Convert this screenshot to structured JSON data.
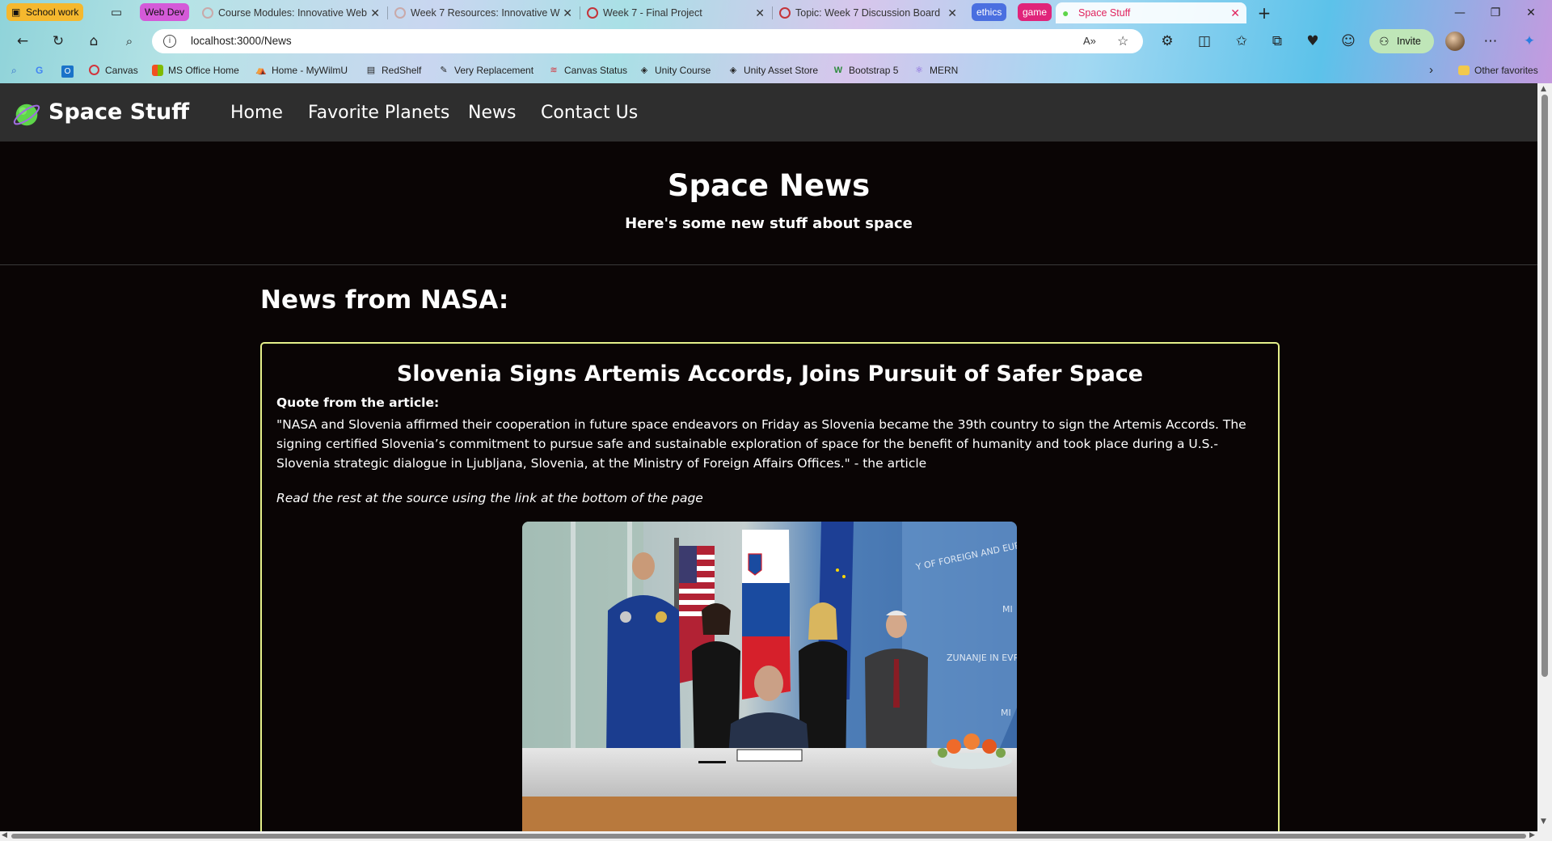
{
  "browser": {
    "tab_groups": [
      {
        "label": "School work",
        "color": "#f5b82e"
      },
      {
        "label": "Web Dev",
        "color": "#d45ad8"
      },
      {
        "label": "ethics",
        "color": "#4a6fe0"
      },
      {
        "label": "game",
        "color": "#e0247a"
      }
    ],
    "tabs": [
      {
        "title": "Course Modules: Innovative Web",
        "favicon": "canvas-icon"
      },
      {
        "title": "Week 7 Resources: Innovative W",
        "favicon": "canvas-icon"
      },
      {
        "title": "Week 7 - Final Project",
        "favicon": "canvas-icon"
      },
      {
        "title": "Topic: Week 7 Discussion Board",
        "favicon": "canvas-icon"
      },
      {
        "title": "Space Stuff",
        "favicon": "planet-icon",
        "active": true
      }
    ],
    "address_bar": {
      "url": "localhost:3000/News"
    },
    "invite_label": "Invite",
    "bookmarks": [
      {
        "label": "Canvas",
        "icon": "canvas-icon"
      },
      {
        "label": "MS Office Home",
        "icon": "office-icon"
      },
      {
        "label": "Home - MyWilmU",
        "icon": "wilmu-icon"
      },
      {
        "label": "RedShelf",
        "icon": "book-icon"
      },
      {
        "label": "Very Replacement",
        "icon": "pen-icon"
      },
      {
        "label": "Canvas Status",
        "icon": "status-icon"
      },
      {
        "label": "Unity Course",
        "icon": "unity-icon"
      },
      {
        "label": "Unity Asset Store",
        "icon": "unity-icon"
      },
      {
        "label": "Bootstrap 5",
        "icon": "bootstrap-icon"
      },
      {
        "label": "MERN",
        "icon": "react-icon"
      }
    ],
    "other_favorites_label": "Other favorites"
  },
  "site": {
    "brand": "Space Stuff",
    "nav": [
      {
        "label": "Home"
      },
      {
        "label": "Favorite Planets"
      },
      {
        "label": "News"
      },
      {
        "label": "Contact Us"
      }
    ],
    "hero": {
      "title": "Space News",
      "subtitle": "Here's some new stuff about space"
    },
    "section_heading": "News from NASA:",
    "article": {
      "title": "Slovenia Signs Artemis Accords, Joins Pursuit of Safer Space",
      "quote_label": "Quote from the article:",
      "quote": "\"NASA and Slovenia affirmed their cooperation in future space endeavors on Friday as Slovenia became the 39th country to sign the Artemis Accords. The signing certified Slovenia’s commitment to pursue safe and sustainable exploration of space for the benefit of humanity and took place during a U.S.-Slovenia strategic dialogue in Ljubljana, Slovenia, at the Ministry of Foreign Affairs Offices.\" - the article",
      "read_more": "Read the rest at the source using the link at the bottom of the page",
      "photo_wall_text": [
        "Y OF FOREIGN AND EURO",
        "MI",
        "ZUNANJE IN EVRO",
        "MI"
      ]
    },
    "colors": {
      "navbar_bg": "#2e2e2e",
      "page_bg": "#0a0505",
      "card_border": "#e5f08a",
      "brand_logo": "#5ed54a"
    }
  }
}
